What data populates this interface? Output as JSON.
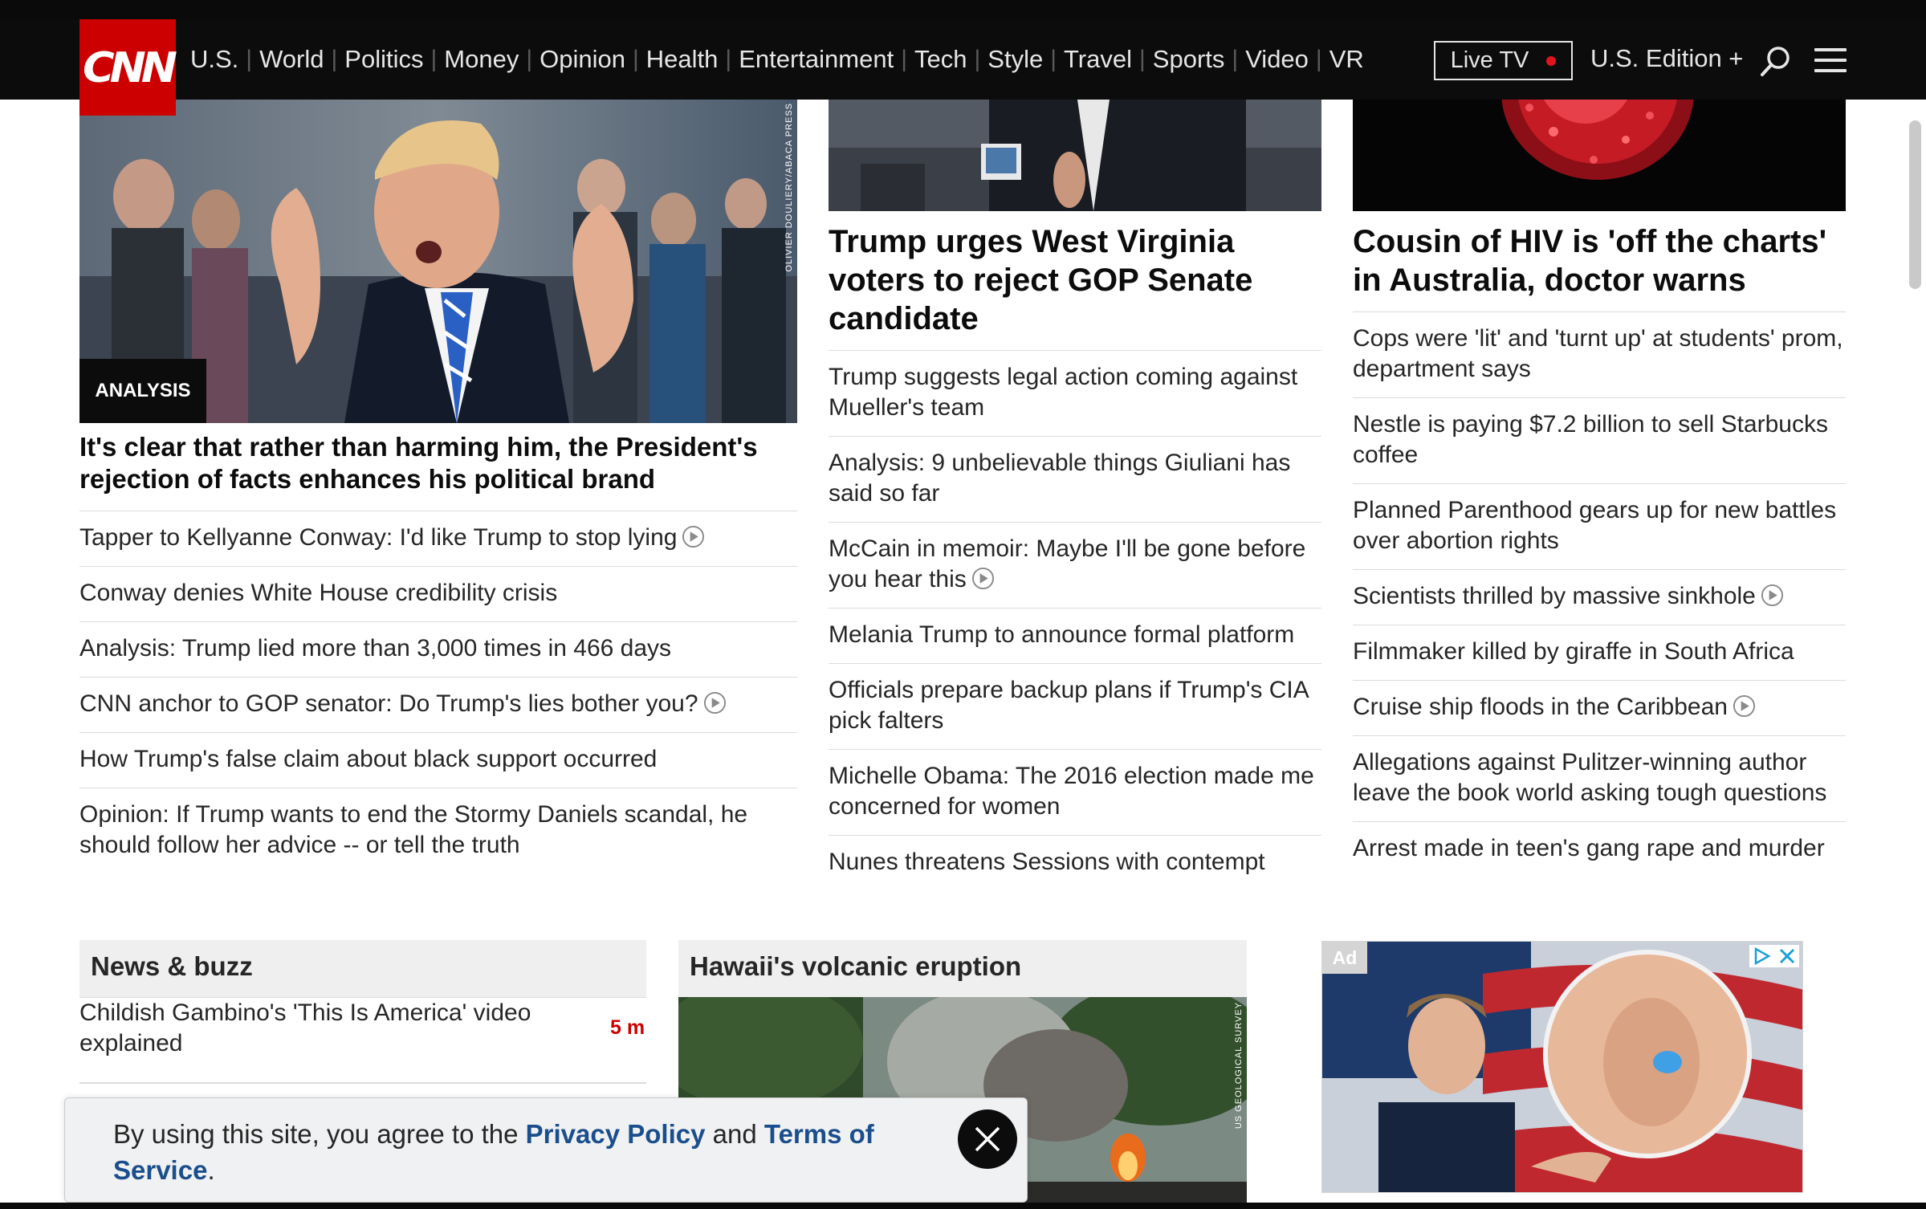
{
  "nav": {
    "logo": "CNN",
    "links": [
      "U.S.",
      "World",
      "Politics",
      "Money",
      "Opinion",
      "Health",
      "Entertainment",
      "Tech",
      "Style",
      "Travel",
      "Sports",
      "Video",
      "VR"
    ],
    "live_tv_label": "Live TV",
    "edition_label": "U.S. Edition +"
  },
  "col1": {
    "image_credit": "OLIVIER DOULIERY/ABACA PRESS",
    "badge": "ANALYSIS",
    "headline": "It's clear that rather than harming him, the President's rejection of facts enhances his political brand",
    "stories": [
      {
        "text": "Tapper to Kellyanne Conway: I'd like Trump to stop lying",
        "video": true
      },
      {
        "text": "Conway denies White House credibility crisis",
        "video": false
      },
      {
        "text": "Analysis: Trump lied more than 3,000 times in 466 days",
        "video": false
      },
      {
        "text": "CNN anchor to GOP senator: Do Trump's lies bother you?",
        "video": true
      },
      {
        "text": "How Trump's false claim about black support occurred",
        "video": false
      },
      {
        "text": "Opinion: If Trump wants to end the Stormy Daniels scandal, he should follow her advice -- or tell the truth",
        "video": false
      }
    ]
  },
  "col2": {
    "headline": "Trump urges West Virginia voters to reject GOP Senate candidate",
    "stories": [
      {
        "text": "Trump suggests legal action coming against Mueller's team",
        "video": false
      },
      {
        "text": "Analysis: 9 unbelievable things Giuliani has said so far",
        "video": false
      },
      {
        "text": "McCain in memoir: Maybe I'll be gone before you hear this",
        "video": true
      },
      {
        "text": "Melania Trump to announce formal platform",
        "video": false
      },
      {
        "text": "Officials prepare backup plans if Trump's CIA pick falters",
        "video": false
      },
      {
        "text": "Michelle Obama: The 2016 election made me concerned for women",
        "video": false
      },
      {
        "text": "Nunes threatens Sessions with contempt",
        "video": false
      }
    ]
  },
  "col3": {
    "headline": "Cousin of HIV is 'off the charts' in Australia, doctor warns",
    "stories": [
      {
        "text": "Cops were 'lit' and 'turnt up' at students' prom, department says",
        "video": false
      },
      {
        "text": "Nestle is paying $7.2 billion to sell Starbucks coffee",
        "video": false
      },
      {
        "text": "Planned Parenthood gears up for new battles over abortion rights",
        "video": false
      },
      {
        "text": "Scientists thrilled by massive sinkhole",
        "video": true
      },
      {
        "text": "Filmmaker killed by giraffe in South Africa",
        "video": false
      },
      {
        "text": "Cruise ship floods in the Caribbean",
        "video": true
      },
      {
        "text": "Allegations against Pulitzer-winning author leave the book world asking tough questions",
        "video": false
      },
      {
        "text": "Arrest made in teen's gang rape and murder",
        "video": false
      }
    ]
  },
  "buzz": {
    "title": "News & buzz",
    "item_text": "Childish Gambino's 'This Is America' video explained",
    "item_time": "5 m"
  },
  "volcano": {
    "title": "Hawaii's volcanic eruption",
    "image_credit": "US GEOLOGICAL SURVEY"
  },
  "ad": {
    "label": "Ad"
  },
  "cookie": {
    "prefix": "By using this site, you agree to the ",
    "privacy_link": "Privacy Policy",
    "middle": " and ",
    "terms_link": "Terms of Service",
    "suffix": "."
  },
  "colors": {
    "brand_red": "#cc0000",
    "nav_bg": "#0c0c0c",
    "link_blue": "#1a4e8c"
  }
}
